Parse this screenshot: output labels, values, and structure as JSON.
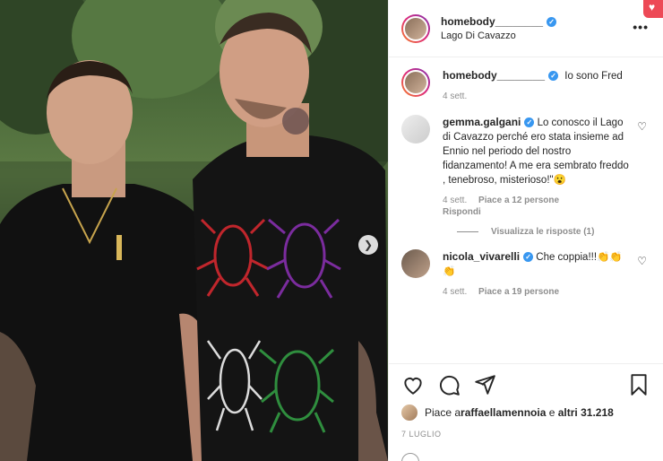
{
  "post": {
    "author": "homebody________",
    "location": "Lago Di Cavazzo",
    "more_icon": "more-horizontal-icon"
  },
  "comments": [
    {
      "user": "homebody________",
      "text": "Io sono Fred",
      "time": "4 sett."
    },
    {
      "user": "gemma.galgani",
      "text": "Lo conosco il Lago di Cavazzo perché ero stata insieme ad Ennio nel periodo del nostro fidanzamento! A me era sembrato freddo , tenebroso, misterioso!\"😮",
      "time": "4 sett.",
      "likes": "Piace a 12 persone",
      "reply": "Rispondi"
    },
    {
      "user": "nicola_vivarelli",
      "text": "Che coppia!!!👏👏👏",
      "time": "4 sett.",
      "likes": "Piace a 19 persone"
    }
  ],
  "view_replies": "Visualizza le risposte (1)",
  "likes_line": {
    "prefix": "Piace a ",
    "user": "raffaellamennoia",
    "middle": " e ",
    "others": "altri 31.218"
  },
  "date": "7 LUGLIO",
  "colors": {
    "verified": "#3897f0",
    "accent": "#ed4956"
  }
}
